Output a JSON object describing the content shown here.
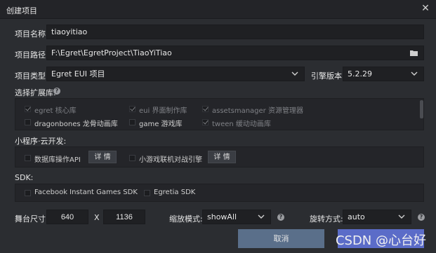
{
  "window": {
    "title": "创建项目",
    "close_icon": "close-icon"
  },
  "project_name": {
    "label": "项目名称:",
    "value": "tiaoyitiao"
  },
  "project_path": {
    "label": "项目路径:",
    "value": "F:\\Egret\\EgretProject\\TiaoYiTiao"
  },
  "project_type": {
    "label": "项目类型:",
    "value": "Egret EUI 项目"
  },
  "engine_version": {
    "label": "引擎版本:",
    "value": "5.2.29"
  },
  "extensions": {
    "label": "选择扩展库:",
    "items": [
      {
        "label": "egret 核心库",
        "checked": true,
        "disabled": true
      },
      {
        "label": "eui 界面制作库",
        "checked": true,
        "disabled": true
      },
      {
        "label": "assetsmanager 资源管理器",
        "checked": true,
        "disabled": true
      },
      {
        "label": "dragonbones 龙骨动画库",
        "checked": false,
        "disabled": false
      },
      {
        "label": "game 游戏库",
        "checked": false,
        "disabled": false
      },
      {
        "label": "tween 缓动动画库",
        "checked": true,
        "disabled": true
      }
    ]
  },
  "cloud": {
    "label": "小程序·云开发:",
    "items": [
      {
        "label": "数据库操作API",
        "detail": "详 情"
      },
      {
        "label": "小游戏联机对战引擎",
        "detail": "详 情"
      }
    ]
  },
  "sdk": {
    "label": "SDK:",
    "items": [
      {
        "label": "Facebook Instant Games SDK"
      },
      {
        "label": "Egretia SDK"
      }
    ]
  },
  "stage": {
    "label": "舞台尺寸:",
    "width": "640",
    "x_label": "X",
    "height": "1136",
    "scale_label": "缩放模式:",
    "scale_value": "showAll",
    "rotate_label": "旋转方式:",
    "rotate_value": "auto"
  },
  "buttons": {
    "cancel": "取消",
    "ok": ""
  },
  "watermark": "CSDN @心台好"
}
